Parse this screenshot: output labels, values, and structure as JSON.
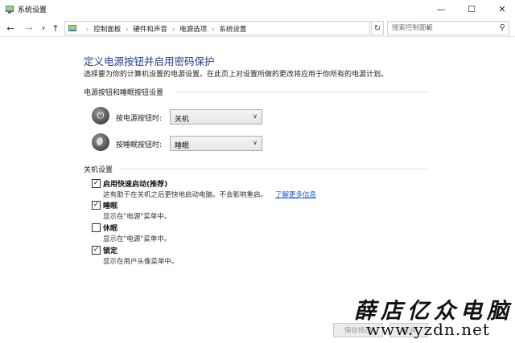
{
  "window": {
    "title": "系统设置",
    "icons": {
      "app": "control-panel-icon",
      "minimize": "minimize-icon",
      "maximize": "maximize-icon",
      "close": "close-icon"
    }
  },
  "nav": {
    "back_icon": "back-arrow-icon",
    "forward_icon": "forward-arrow-icon",
    "recent_icon": "chevron-down-icon",
    "up_icon": "up-arrow-icon",
    "breadcrumbs": [
      "控制面板",
      "硬件和声音",
      "电源选项",
      "系统设置"
    ],
    "refresh_icon": "refresh-icon",
    "search_placeholder": "搜索控制面板"
  },
  "main": {
    "title": "定义电源按钮并启用密码保护",
    "description": "选择要为你的计算机设置的电源设置。在此页上对设置所做的更改将应用于你所有的电源计划。",
    "buttons_group": {
      "title": "电源按钮和睡眠按钮设置",
      "rows": [
        {
          "label": "按电源按钮时:",
          "value": "关机",
          "icon": "power-button-icon"
        },
        {
          "label": "按睡眠按钮时:",
          "value": "睡眠",
          "icon": "sleep-button-icon"
        }
      ]
    },
    "shutdown_group": {
      "title": "关机设置",
      "options": [
        {
          "label": "启用快速启动(推荐)",
          "desc": "这有助于在关机之后更快地启动电脑。不会影响重启。",
          "link": "了解更多信息",
          "checked": true
        },
        {
          "label": "睡眠",
          "desc": "显示在\"电源\"菜单中。",
          "checked": true
        },
        {
          "label": "休眠",
          "desc": "显示在\"电源\"菜单中。",
          "checked": false
        },
        {
          "label": "锁定",
          "desc": "显示在用户头像菜单中。",
          "checked": true
        }
      ]
    }
  },
  "footer": {
    "save_label": "保存修改",
    "cancel_label": "取消"
  },
  "watermark": {
    "text": "薛店亿众电脑",
    "url": "www.yzdn.net"
  },
  "colors": {
    "title_blue": "#1e3f8a",
    "link_blue": "#1155cc"
  }
}
